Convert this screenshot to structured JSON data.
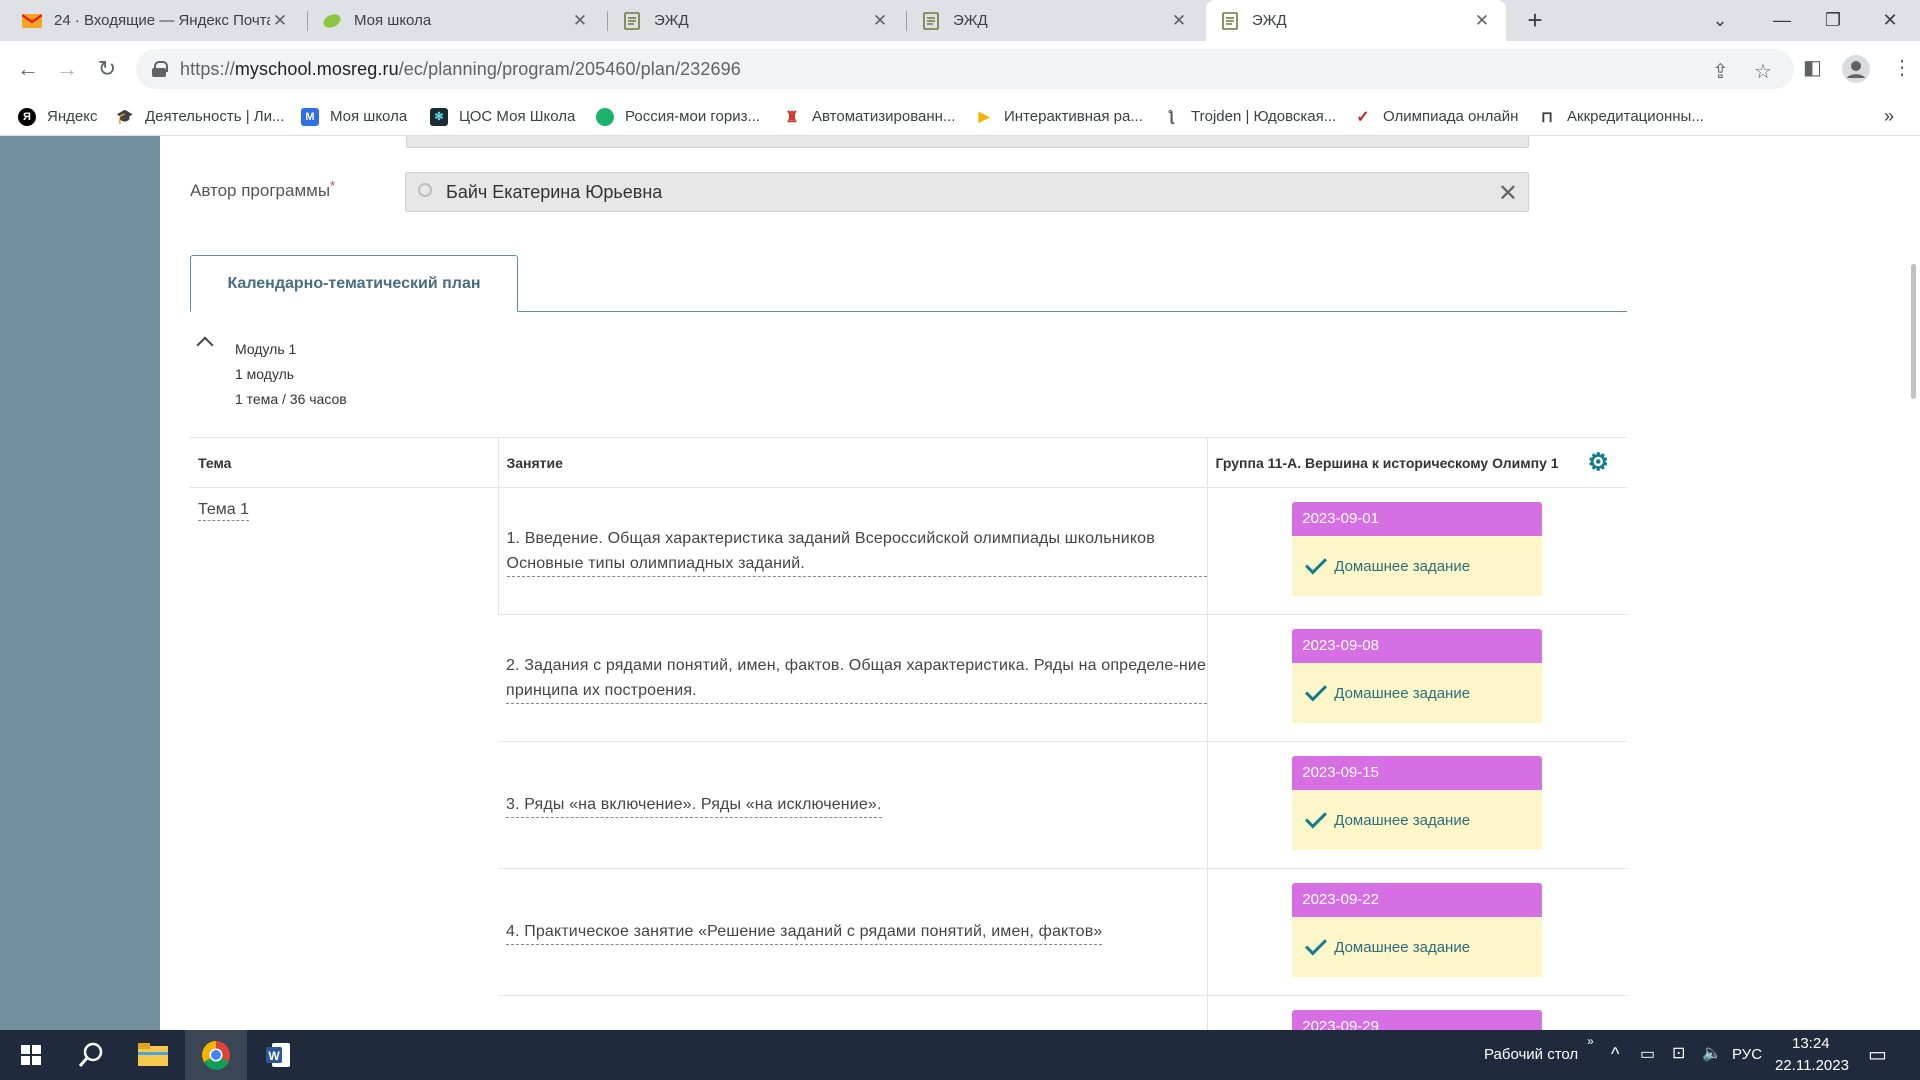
{
  "browser": {
    "tabs": [
      {
        "title": "24 · Входящие — Яндекс Почта",
        "icon": "mail-icon",
        "active": false
      },
      {
        "title": "Моя школа",
        "icon": "leaf-icon",
        "active": false
      },
      {
        "title": "ЭЖД",
        "icon": "journal-icon",
        "active": false
      },
      {
        "title": "ЭЖД",
        "icon": "journal-icon",
        "active": false
      },
      {
        "title": "ЭЖД",
        "icon": "journal-icon",
        "active": true
      }
    ],
    "url_prefix": "https://",
    "url_host": "myschool.mosreg.ru",
    "url_path": "/ec/planning/program/205460/plan/232696",
    "bookmarks": [
      {
        "label": "Яндекс",
        "color": "#000000",
        "glyph": "Я"
      },
      {
        "label": "Деятельность | Ли...",
        "color": "#555555",
        "glyph": "▲"
      },
      {
        "label": "Моя школа",
        "color": "#2f6ee8",
        "glyph": "M"
      },
      {
        "label": "ЦОС Моя Школа",
        "color": "#1b2a33",
        "glyph": "✻"
      },
      {
        "label": "Россия-мои гориз...",
        "color": "#1bb36b",
        "glyph": "●"
      },
      {
        "label": "Автоматизированн...",
        "color": "#d03b2d",
        "glyph": "♜"
      },
      {
        "label": "Интерактивная ра...",
        "color": "#f2b400",
        "glyph": "▶"
      },
      {
        "label": "Trojden | Юдовская...",
        "color": "#777777",
        "glyph": "ƪ"
      },
      {
        "label": "Олимпиада онлайн",
        "color": "#d11d1d",
        "glyph": "✓"
      },
      {
        "label": "Аккредитационны...",
        "color": "#3c4043",
        "glyph": "⊓"
      }
    ]
  },
  "form": {
    "author_label": "Автор программы",
    "required_mark": "*",
    "author_value": "Байч Екатерина Юрьевна"
  },
  "ktp_tab_label": "Календарно-тематический план",
  "module": {
    "title": "Модуль 1",
    "line2": "1 модуль",
    "line3": "1 тема / 36 часов"
  },
  "table": {
    "headers": {
      "theme": "Тема",
      "lesson": "Занятие",
      "group": "Группа 11-А. Вершина к историческому Олимпу 1"
    },
    "theme_name": "Тема 1",
    "homework_label": "Домашнее задание",
    "rows": [
      {
        "lesson": "1. Введение. Общая характеристика заданий Всероссийской олимпиады школьников Основные типы олимпиадных заданий.",
        "date": "2023-09-01"
      },
      {
        "lesson": "2. Задания с рядами понятий, имен, фактов. Общая характеристика. Ряды на определе-ние принципа их построения.",
        "date": "2023-09-08"
      },
      {
        "lesson": "3. Ряды «на включение». Ряды «на исключение».",
        "date": "2023-09-15"
      },
      {
        "lesson": "4. Практическое занятие «Решение заданий с рядами понятий, имен, фактов»",
        "date": "2023-09-22"
      },
      {
        "lesson": "",
        "date": "2023-09-29"
      }
    ]
  },
  "taskbar": {
    "desktop_label": "Рабочий стол",
    "lang": "РУС",
    "time": "13:24",
    "date": "22.11.2023"
  }
}
